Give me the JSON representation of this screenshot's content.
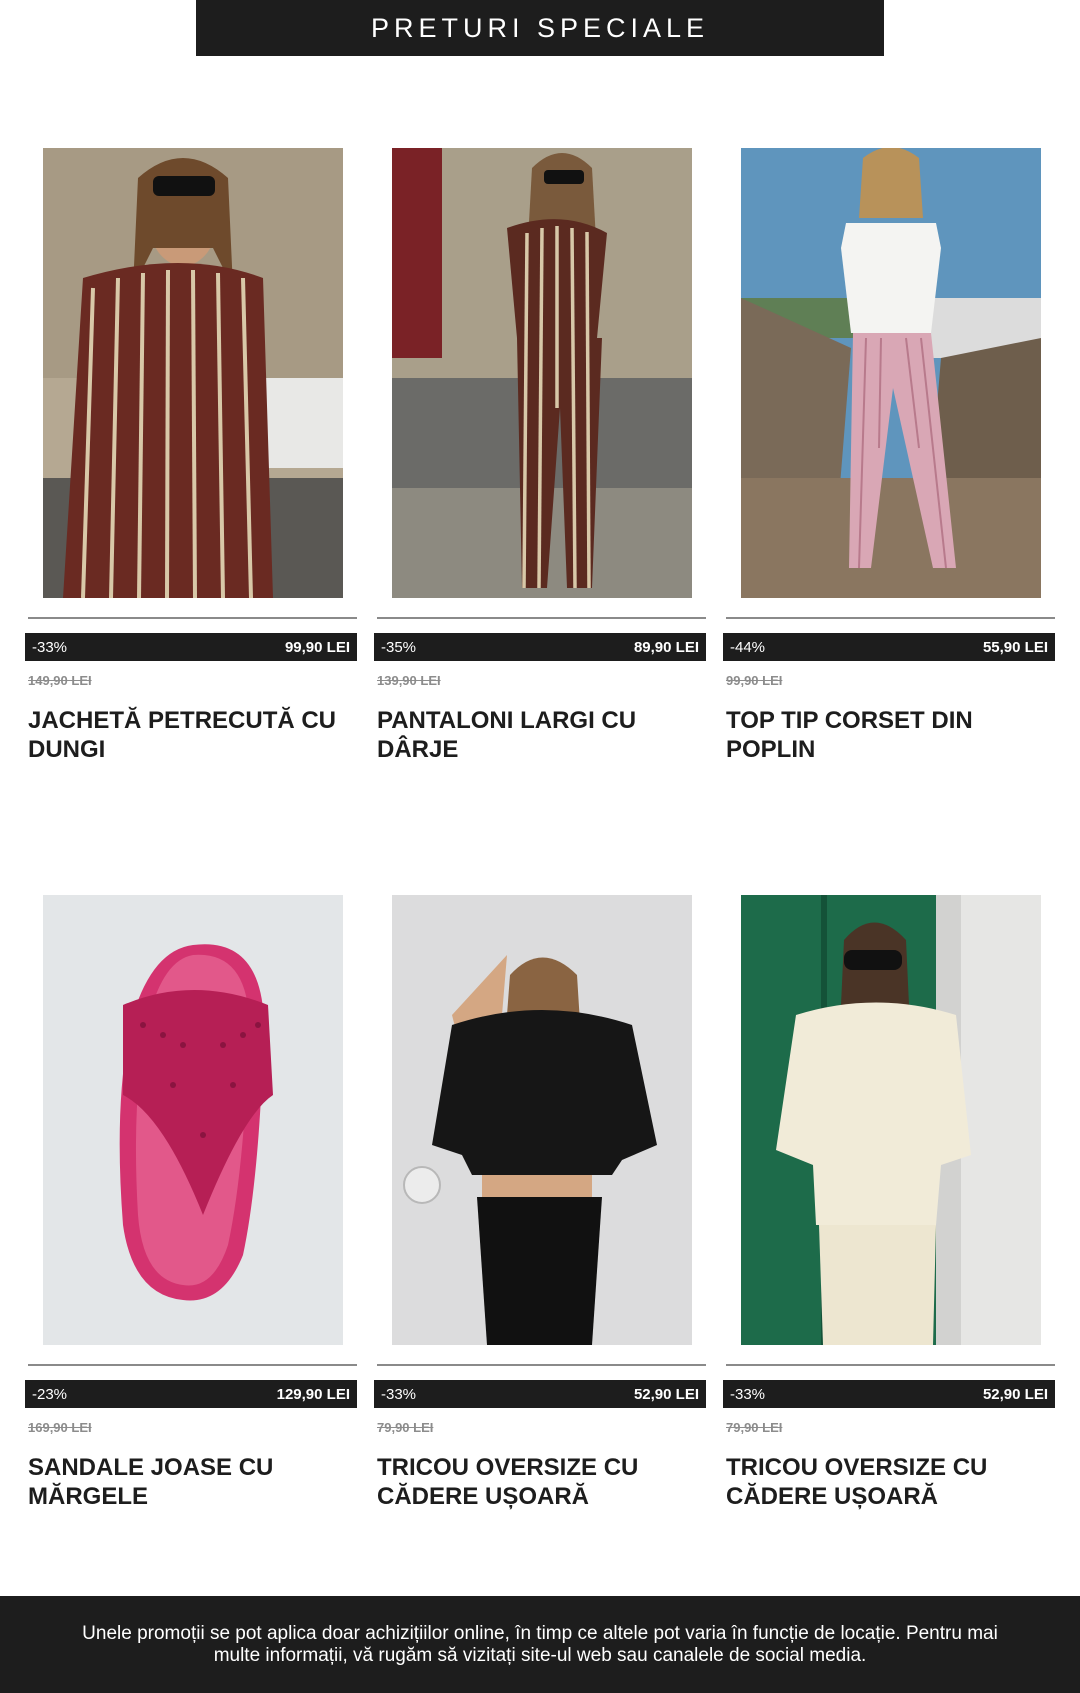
{
  "banner": {
    "title": "PRETURI SPECIALE"
  },
  "products": [
    {
      "discount": "-33%",
      "price": "99,90 LEI",
      "old_price": "149,90 LEI",
      "name": "JACHETĂ PETRECUTĂ CU DUNGI",
      "image": "woman-striped-wrap-jacket-photo"
    },
    {
      "discount": "-35%",
      "price": "89,90 LEI",
      "old_price": "139,90 LEI",
      "name": "PANTALONI LARGI CU DÂRJE",
      "image": "woman-striped-wide-trousers-photo"
    },
    {
      "discount": "-44%",
      "price": "55,90 LEI",
      "old_price": "99,90 LEI",
      "name": "TOP TIP CORSET DIN POPLIN",
      "image": "woman-white-corset-top-photo"
    },
    {
      "discount": "-23%",
      "price": "129,90 LEI",
      "old_price": "169,90 LEI",
      "name": "SANDALE JOASE CU MĂRGELE",
      "image": "pink-beaded-sandal-photo"
    },
    {
      "discount": "-33%",
      "price": "52,90 LEI",
      "old_price": "79,90 LEI",
      "name": "TRICOU OVERSIZE CU CĂDERE UȘOARĂ",
      "image": "woman-black-oversize-tee-photo"
    },
    {
      "discount": "-33%",
      "price": "52,90 LEI",
      "old_price": "79,90 LEI",
      "name": "TRICOU OVERSIZE CU CĂDERE UȘOARĂ",
      "image": "woman-cream-oversize-tee-photo"
    }
  ],
  "footer": {
    "text": "Unele promoții se pot aplica doar achizițiilor online, în timp ce altele pot varia în funcție de locație. Pentru mai multe informații, vă rugăm să vizitați site-ul web sau canalele de social media."
  },
  "colors": {
    "dark": "#1d1d1d",
    "muted": "#8c8c8c",
    "background": "#ffffff"
  }
}
